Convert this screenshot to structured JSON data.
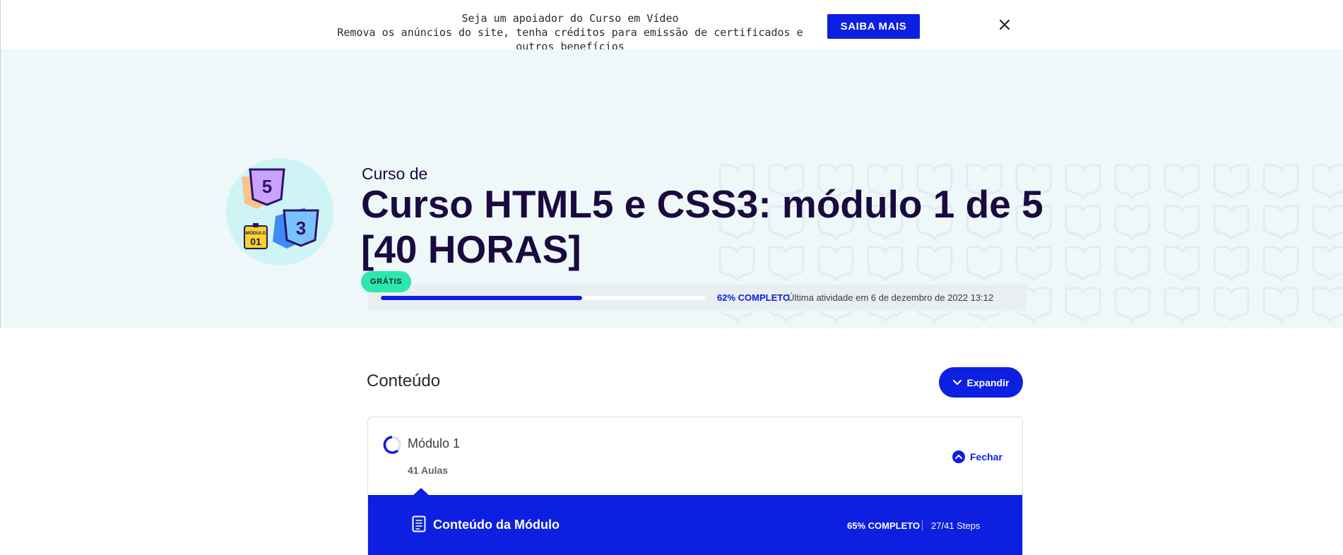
{
  "banner": {
    "line1": "Seja um apoiador do Curso em Vídeo",
    "line2": "Remova os anúncios do site, tenha créditos para emissão de certificados e outros benefícios",
    "cta_label": "SAIBA MAIS",
    "close_icon": "close-icon"
  },
  "course": {
    "badge_module_label": "MÓDULO",
    "badge_module_number": "01",
    "prefix": "Curso de",
    "title": "Curso HTML5 e CSS3: módulo 1 de 5 [40 HORAS]",
    "tag": "GRÁTIS",
    "progress_percent": 62,
    "progress_label": "62% COMPLETO",
    "last_activity": "Última atividade em 6 de dezembro de 2022 13:12"
  },
  "content": {
    "heading": "Conteúdo",
    "expand_label": "Expandir",
    "module": {
      "name": "Módulo 1",
      "lessons": "41 Aulas",
      "close_label": "Fechar",
      "bar_title": "Conteúdo da Módulo",
      "bar_percent": "65% COMPLETO",
      "bar_steps": "27/41 Steps"
    }
  },
  "colors": {
    "accent": "#0d1fe0",
    "hero_bg": "#eff8f9",
    "title_text": "#1b0a3f",
    "tag_bg": "#2ee8ab"
  }
}
